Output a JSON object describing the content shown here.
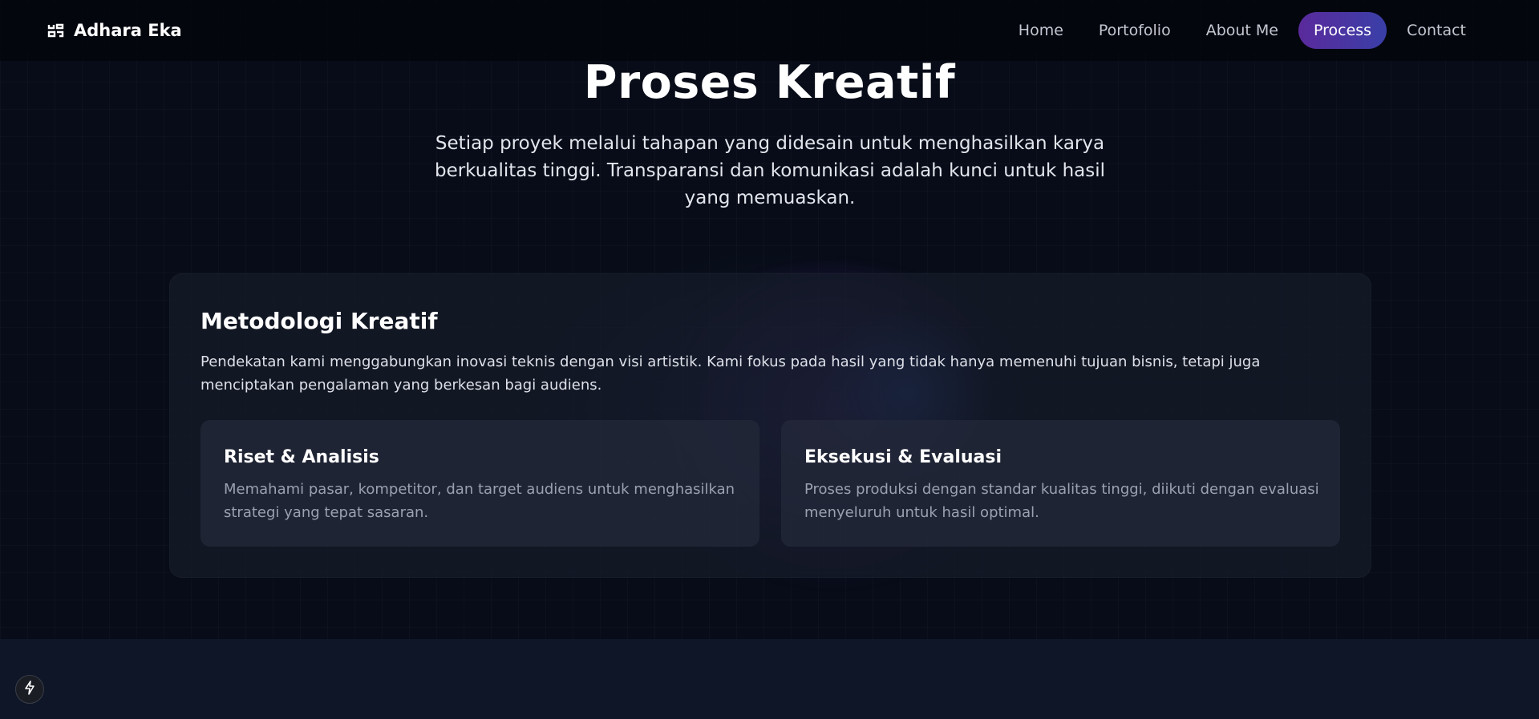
{
  "brand": {
    "name": "Adhara Eka",
    "icon": "logo-glyph-icon"
  },
  "nav": {
    "items": [
      {
        "label": "Home"
      },
      {
        "label": "Portofolio"
      },
      {
        "label": "About Me"
      },
      {
        "label": "Process",
        "active": true
      },
      {
        "label": "Contact"
      }
    ]
  },
  "hero": {
    "title": "Proses Kreatif",
    "subtitle": "Setiap proyek melalui tahapan yang didesain untuk menghasilkan karya berkualitas tinggi. Transparansi dan komunikasi adalah kunci untuk hasil yang memuaskan."
  },
  "methodology": {
    "title": "Metodologi Kreatif",
    "description": "Pendekatan kami menggabungkan inovasi teknis dengan visi artistik. Kami fokus pada hasil yang tidak hanya memenuhi tujuan bisnis, tetapi juga menciptakan pengalaman yang berkesan bagi audiens.",
    "cards": [
      {
        "title": "Riset & Analisis",
        "description": "Memahami pasar, kompetitor, dan target audiens untuk menghasilkan strategi yang tepat sasaran."
      },
      {
        "title": "Eksekusi & Evaluasi",
        "description": "Proses produksi dengan standar kualitas tinggi, diikuti dengan evaluasi menyeluruh untuk hasil optimal."
      }
    ]
  },
  "fab": {
    "icon": "lightning-icon"
  },
  "colors": {
    "background": "#080c18",
    "accent_start": "#5a2a9c",
    "accent_end": "#3a3fa8",
    "bottom_section": "#0f1628"
  }
}
